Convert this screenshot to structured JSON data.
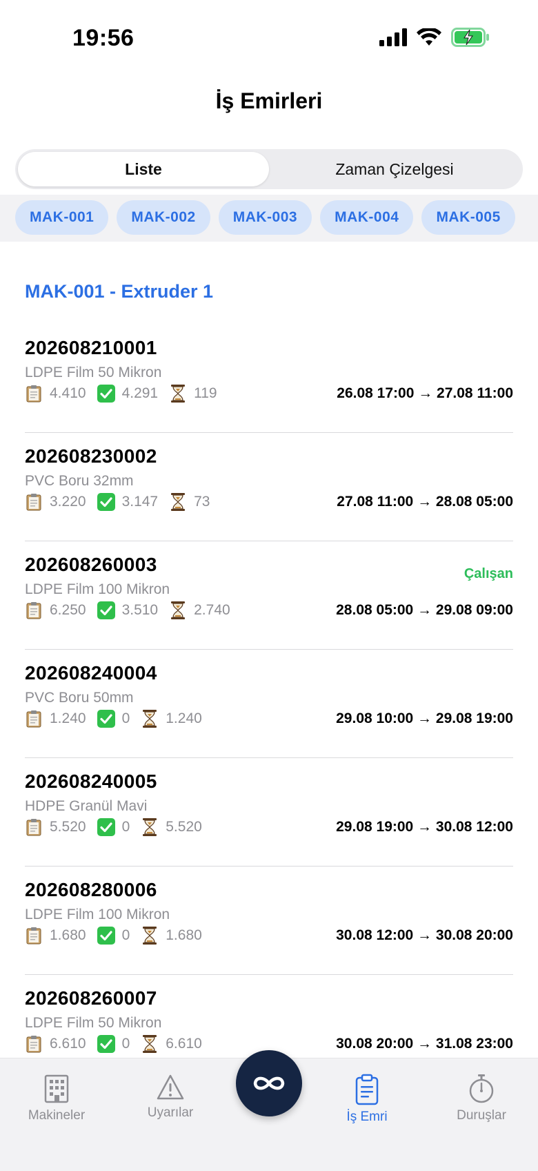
{
  "status_bar": {
    "time": "19:56"
  },
  "header": {
    "title": "İş Emirleri"
  },
  "segments": [
    {
      "label": "Liste",
      "active": true
    },
    {
      "label": "Zaman Çizelgesi",
      "active": false
    }
  ],
  "machines": [
    "MAK-001",
    "MAK-002",
    "MAK-003",
    "MAK-004",
    "MAK-005"
  ],
  "section": {
    "title": "MAK-001 - Extruder 1"
  },
  "orders": [
    {
      "no": "202608210001",
      "product": "LDPE Film 50 Mikron",
      "planned": "4.410",
      "done": "4.291",
      "remaining": "119",
      "dates": "26.08 17:00 → 27.08 11:00",
      "status": ""
    },
    {
      "no": "202608230002",
      "product": "PVC Boru 32mm",
      "planned": "3.220",
      "done": "3.147",
      "remaining": "73",
      "dates": "27.08 11:00 → 28.08 05:00",
      "status": ""
    },
    {
      "no": "202608260003",
      "product": "LDPE Film 100 Mikron",
      "planned": "6.250",
      "done": "3.510",
      "remaining": "2.740",
      "dates": "28.08 05:00 → 29.08 09:00",
      "status": "Çalışan"
    },
    {
      "no": "202608240004",
      "product": "PVC Boru 50mm",
      "planned": "1.240",
      "done": "0",
      "remaining": "1.240",
      "dates": "29.08 10:00 → 29.08 19:00",
      "status": ""
    },
    {
      "no": "202608240005",
      "product": "HDPE Granül Mavi",
      "planned": "5.520",
      "done": "0",
      "remaining": "5.520",
      "dates": "29.08 19:00 → 30.08 12:00",
      "status": ""
    },
    {
      "no": "202608280006",
      "product": "LDPE Film 100 Mikron",
      "planned": "1.680",
      "done": "0",
      "remaining": "1.680",
      "dates": "30.08 12:00 → 30.08 20:00",
      "status": ""
    },
    {
      "no": "202608260007",
      "product": "LDPE Film 50 Mikron",
      "planned": "6.610",
      "done": "0",
      "remaining": "6.610",
      "dates": "30.08 20:00 → 31.08 23:00",
      "status": ""
    }
  ],
  "tabbar": {
    "items": [
      {
        "label": "Makineler",
        "icon": "building-icon",
        "active": false
      },
      {
        "label": "Uyarılar",
        "icon": "warning-icon",
        "active": false
      },
      {
        "label": "İş Emri",
        "icon": "clipboard-icon",
        "active": true
      },
      {
        "label": "Duruşlar",
        "icon": "stopwatch-icon",
        "active": false
      }
    ],
    "center_icon": "infinity-icon"
  },
  "colors": {
    "accent": "#2c6fe3",
    "running": "#2dbd5a",
    "fab": "#152543",
    "chip_bg": "#d6e4fa"
  }
}
